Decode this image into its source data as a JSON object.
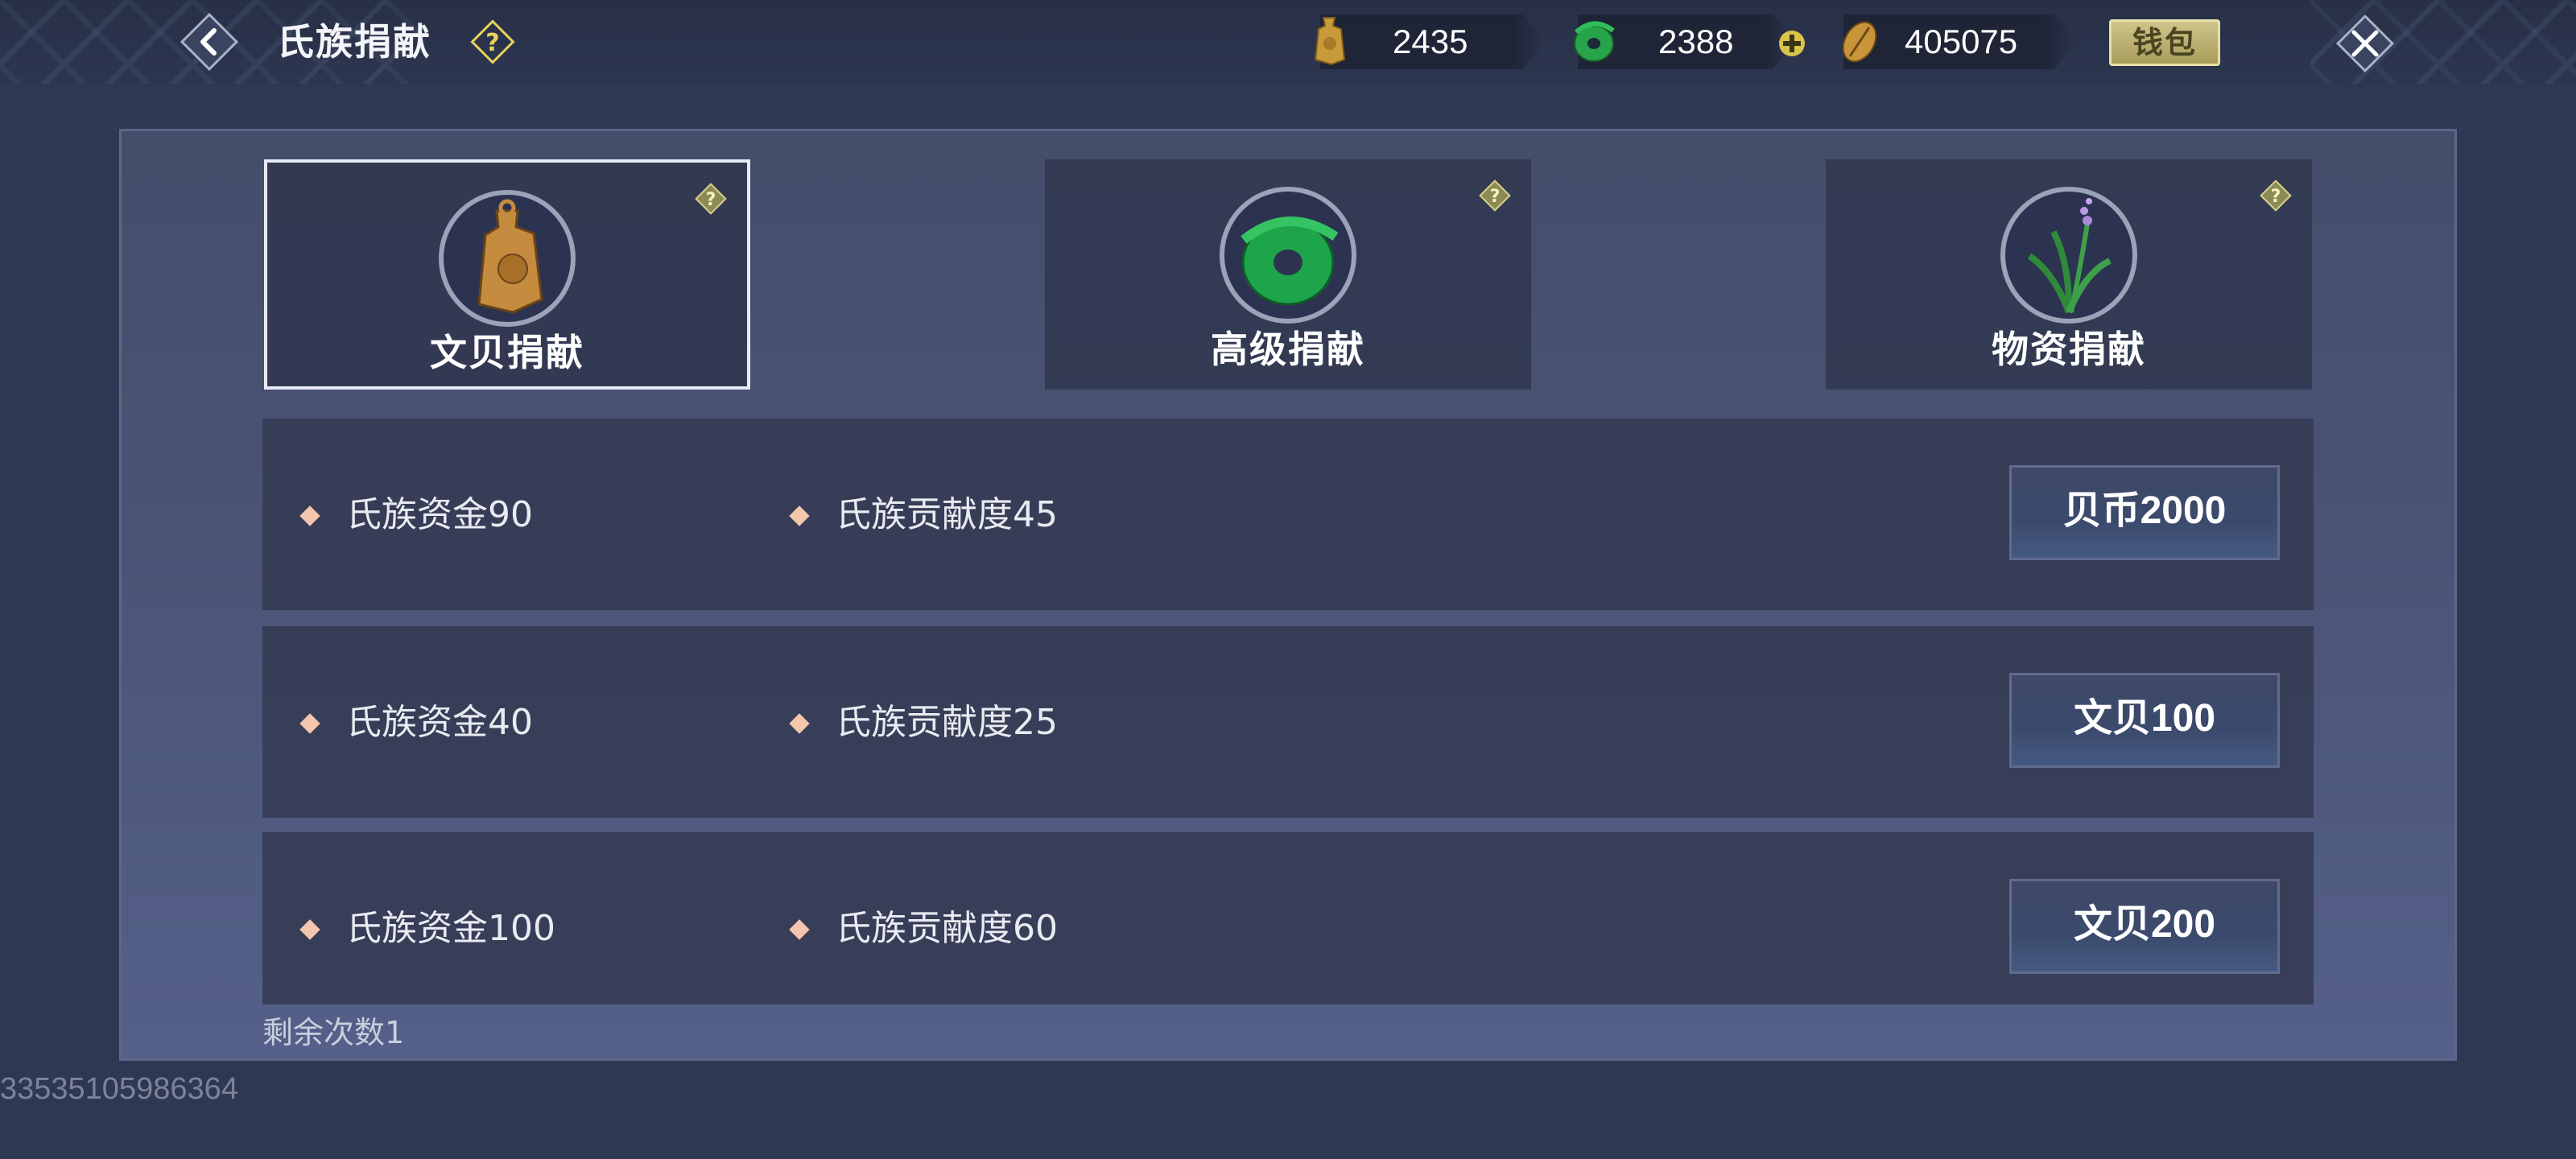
{
  "header": {
    "title": "氏族捐献",
    "wallet_label": "钱包"
  },
  "currencies": [
    {
      "name": "wenbei",
      "icon": "bronze-coin-icon",
      "value": "2435"
    },
    {
      "name": "jade",
      "icon": "jade-coin-icon",
      "value": "2388"
    },
    {
      "name": "shell",
      "icon": "shell-coin-icon",
      "value": "405075"
    }
  ],
  "tabs": [
    {
      "label": "文贝捐献",
      "icon": "bronze-coin-icon",
      "selected": true
    },
    {
      "label": "高级捐献",
      "icon": "jade-coin-icon",
      "selected": false
    },
    {
      "label": "物资捐献",
      "icon": "herb-icon",
      "selected": false
    }
  ],
  "rows": [
    {
      "fund": "氏族资金90",
      "contribution": "氏族贡献度45",
      "price": "贝币2000"
    },
    {
      "fund": "氏族资金40",
      "contribution": "氏族贡献度25",
      "price": "文贝100"
    },
    {
      "fund": "氏族资金100",
      "contribution": "氏族贡献度60",
      "price": "文贝200"
    }
  ],
  "remaining": "剩余次数1",
  "uid": "33535105986364",
  "colors": {
    "background": "#2f3852",
    "panel": "#4a5475",
    "row": "#343a52",
    "diamond": "#f4c6ae",
    "wallet": "#c2b774"
  }
}
